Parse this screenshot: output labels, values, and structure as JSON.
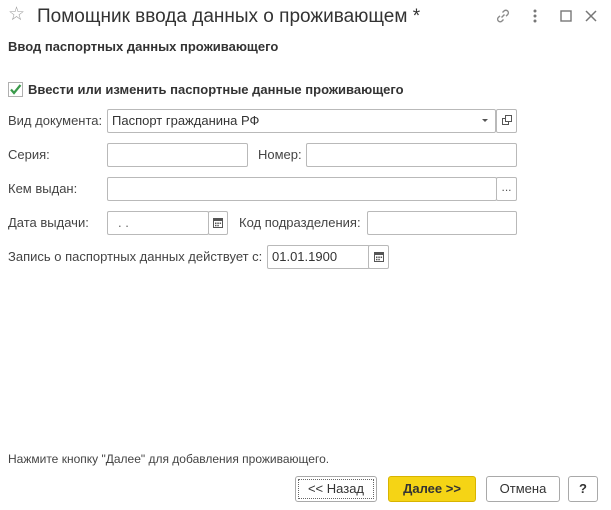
{
  "window": {
    "title": "Помощник ввода данных о проживающем *",
    "subtitle": "Ввод паспортных данных проживающего"
  },
  "form": {
    "change_passport_checkbox": {
      "label": "Ввести или изменить паспортные данные проживающего",
      "checked": true
    },
    "doc_type": {
      "label": "Вид документа:",
      "value": "Паспорт гражданина РФ"
    },
    "series": {
      "label": "Серия:",
      "value": ""
    },
    "number": {
      "label": "Номер:",
      "value": ""
    },
    "issued_by": {
      "label": "Кем выдан:",
      "value": "",
      "select_button": "..."
    },
    "issue_date": {
      "label": "Дата выдачи:",
      "value": " .  ."
    },
    "dept_code": {
      "label": "Код подразделения:",
      "value": ""
    },
    "valid_from": {
      "label": "Запись о паспортных данных действует с:",
      "value": "01.01.1900"
    }
  },
  "footer": {
    "hint": "Нажмите кнопку \"Далее\" для добавления проживающего.",
    "back_label": "<< Назад",
    "next_label": "Далее >>",
    "cancel_label": "Отмена",
    "help_label": "?"
  },
  "colors": {
    "accent": "#f5d415",
    "checkmark": "#3a9a4a"
  }
}
